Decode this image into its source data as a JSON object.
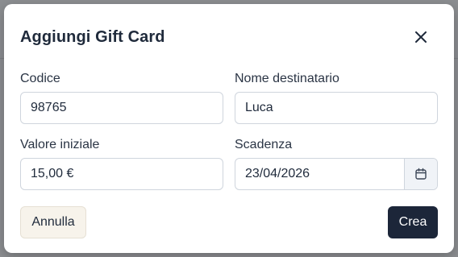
{
  "modal": {
    "title": "Aggiungi Gift Card"
  },
  "fields": {
    "code": {
      "label": "Codice",
      "value": "98765"
    },
    "recipient": {
      "label": "Nome destinatario",
      "value": "Luca"
    },
    "initial_value": {
      "label": "Valore iniziale",
      "value": "15,00 €"
    },
    "expiry": {
      "label": "Scadenza",
      "value": "23/04/2026"
    }
  },
  "actions": {
    "cancel_label": "Annulla",
    "create_label": "Crea"
  },
  "icons": {
    "close": "close-icon",
    "calendar": "calendar-icon"
  },
  "colors": {
    "primary_button": "#1c2639",
    "secondary_button": "#f7f3eb",
    "text": "#1f2a3b",
    "input_border": "#cfd5dd"
  }
}
